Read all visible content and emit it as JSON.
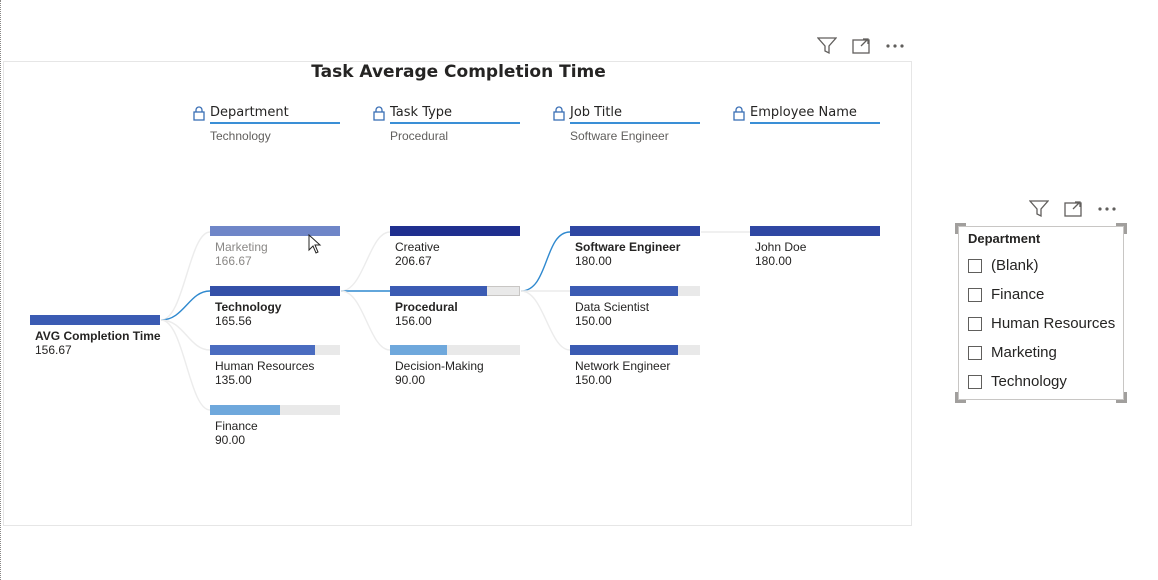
{
  "visual": {
    "title": "Task Average Completion Time",
    "header_icons": [
      "filter-icon",
      "focus-mode-icon",
      "more-options-icon"
    ]
  },
  "levels": [
    {
      "name": "Department",
      "selected": "Technology"
    },
    {
      "name": "Task Type",
      "selected": "Procedural"
    },
    {
      "name": "Job Title",
      "selected": "Software Engineer"
    },
    {
      "name": "Employee Name",
      "selected": ""
    }
  ],
  "root": {
    "label": "AVG Completion Time",
    "value": "156.67"
  },
  "department_nodes": [
    {
      "label": "Marketing",
      "value": "166.67",
      "fill": 1.0
    },
    {
      "label": "Technology",
      "value": "165.56",
      "fill": 1.0
    },
    {
      "label": "Human Resources",
      "value": "135.00",
      "fill": 0.81
    },
    {
      "label": "Finance",
      "value": "90.00",
      "fill": 0.54
    }
  ],
  "task_type_nodes": [
    {
      "label": "Creative",
      "value": "206.67",
      "fill": 1.0
    },
    {
      "label": "Procedural",
      "value": "156.00",
      "fill": 0.75
    },
    {
      "label": "Decision-Making",
      "value": "90.00",
      "fill": 0.44
    }
  ],
  "job_title_nodes": [
    {
      "label": "Software Engineer",
      "value": "180.00",
      "fill": 1.0
    },
    {
      "label": "Data Scientist",
      "value": "150.00",
      "fill": 0.83
    },
    {
      "label": "Network Engineer",
      "value": "150.00",
      "fill": 0.83
    }
  ],
  "employee_nodes": [
    {
      "label": "John Doe",
      "value": "180.00",
      "fill": 1.0
    }
  ],
  "colors": {
    "accent": "#3a8fd6",
    "dark_bar": "#2e3f9e",
    "mid_bar": "#3b5bb3",
    "light_bar": "#6fa8dc",
    "faded_bar": "#6f86c8"
  },
  "slicer": {
    "title": "Department",
    "items": [
      "(Blank)",
      "Finance",
      "Human Resources",
      "Marketing",
      "Technology"
    ]
  }
}
